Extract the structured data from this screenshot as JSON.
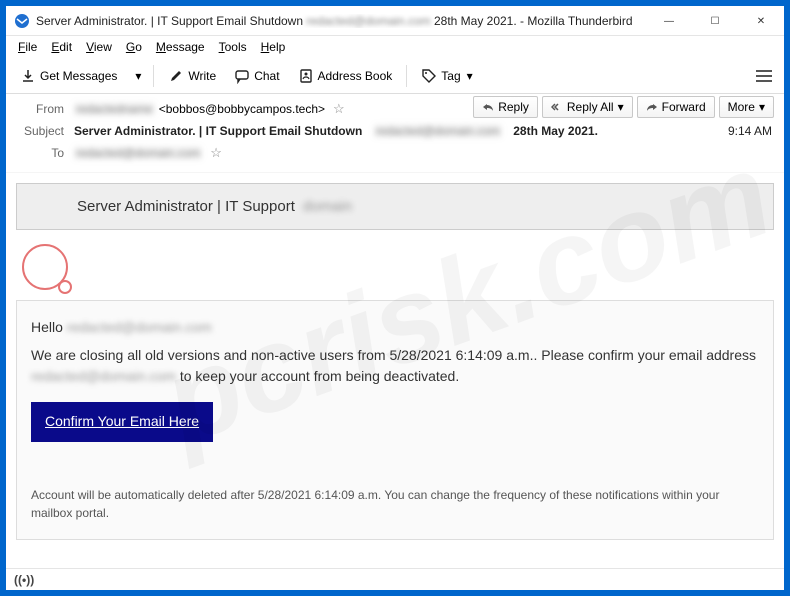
{
  "window": {
    "title_prefix": "Server Administrator. | IT Support Email Shutdown",
    "title_blurred": "redacted@domain.com",
    "title_suffix": "28th May 2021. - Mozilla Thunderbird"
  },
  "menubar": [
    "File",
    "Edit",
    "View",
    "Go",
    "Message",
    "Tools",
    "Help"
  ],
  "toolbar": {
    "get_messages": "Get Messages",
    "write": "Write",
    "chat": "Chat",
    "address_book": "Address Book",
    "tag": "Tag"
  },
  "actions": {
    "reply": "Reply",
    "reply_all": "Reply All",
    "forward": "Forward",
    "more": "More"
  },
  "header": {
    "from_label": "From",
    "from_blur1": "redactedname",
    "from_email": "<bobbos@bobbycampos.tech>",
    "subject_label": "Subject",
    "subject_prefix": "Server Administrator. | IT Support Email Shutdown",
    "subject_blur": "redacted@domain.com",
    "subject_suffix": "28th May 2021.",
    "to_label": "To",
    "to_blur": "redacted@domain.com",
    "time": "9:14 AM"
  },
  "message": {
    "banner_text": "Server Administrator | IT Support",
    "banner_blur": "domain",
    "greeting": "Hello",
    "greeting_blur": "redacted@domain.com",
    "body1": "We are closing all old versions and non-active users from 5/28/2021 6:14:09 a.m.. Please confirm your email address",
    "body_blur": "redacted@domain.com",
    "body2": "to keep your account from being deactivated.",
    "cta": "Confirm Your Email Here",
    "footnote": "Account will be  automatically deleted after 5/28/2021 6:14:09 a.m. You can change the frequency of these notifications within your mailbox portal."
  },
  "watermark": "pcrisk.com"
}
